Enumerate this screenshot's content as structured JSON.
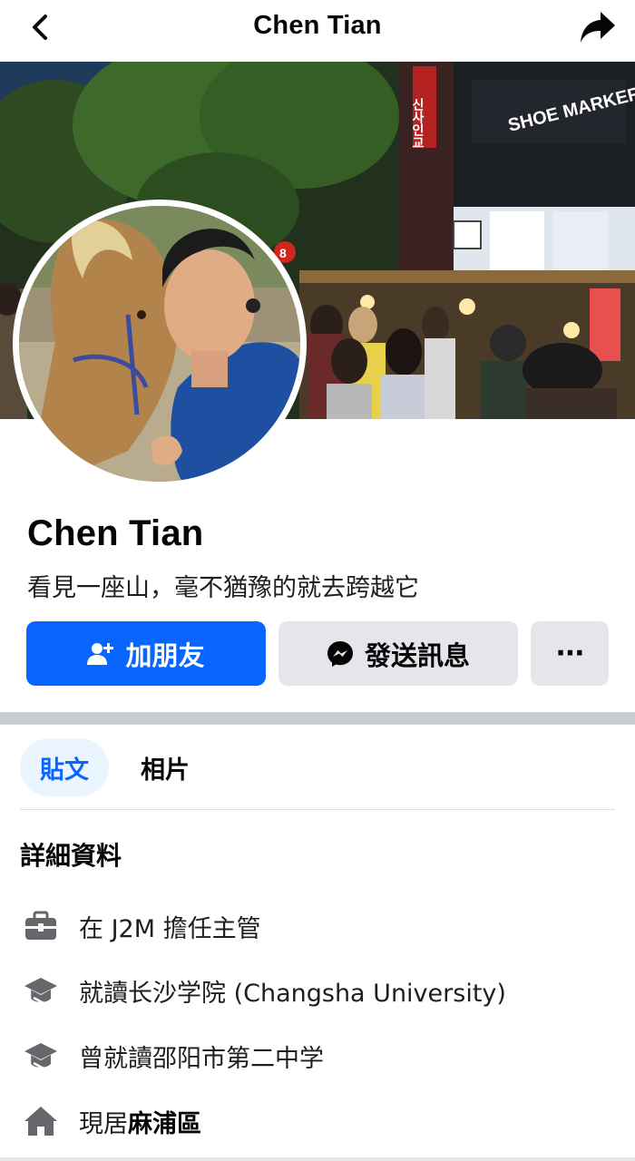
{
  "nav": {
    "title": "Chen Tian",
    "back_icon": "chevron-left-icon",
    "share_icon": "share-arrow-icon"
  },
  "cover": {
    "signs": [
      "SHOE MARKER",
      "신사인교",
      "8"
    ]
  },
  "profile": {
    "name": "Chen Tian",
    "bio": "看見一座山，毫不猶豫的就去跨越它"
  },
  "actions": {
    "add_friend_label": "加朋友",
    "add_friend_icon": "add-person-icon",
    "message_label": "發送訊息",
    "message_icon": "messenger-icon",
    "more_label": "···"
  },
  "tabs": [
    {
      "label": "貼文",
      "active": true
    },
    {
      "label": "相片",
      "active": false
    }
  ],
  "details": {
    "title": "詳細資料",
    "items": [
      {
        "icon": "briefcase-icon",
        "prefix": "在 J2M 擔任主管",
        "bold": ""
      },
      {
        "icon": "graduation-cap-icon",
        "prefix": "就讀长沙学院 (Changsha University)",
        "bold": ""
      },
      {
        "icon": "graduation-cap-icon",
        "prefix": "曾就讀邵阳市第二中学",
        "bold": ""
      },
      {
        "icon": "home-icon",
        "prefix": "現居",
        "bold": "麻浦區"
      }
    ]
  },
  "colors": {
    "primary": "#0866ff",
    "secondary_button": "#e4e6eb",
    "active_tab_bg": "#ebf5ff",
    "divider": "#c9ccd1"
  }
}
